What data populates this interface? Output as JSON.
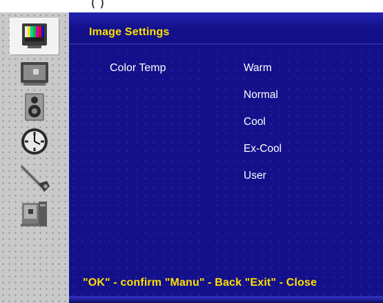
{
  "caption": "(                   )",
  "title": "Image Settings",
  "setting": {
    "label": "Color Temp"
  },
  "options": [
    "Warm",
    "Normal",
    "Cool",
    "Ex-Cool",
    "User"
  ],
  "footer": "\"OK\" - confirm \"Manu\" - Back \"Exit\" - Close",
  "sidebar": {
    "items": [
      {
        "icon": "color-bars-tv-icon",
        "selected": true
      },
      {
        "icon": "monitor-icon",
        "selected": false
      },
      {
        "icon": "speaker-icon",
        "selected": false
      },
      {
        "icon": "clock-icon",
        "selected": false
      },
      {
        "icon": "tools-icon",
        "selected": false
      },
      {
        "icon": "computer-tower-icon",
        "selected": false
      }
    ]
  },
  "colors": {
    "background": "#13108a",
    "title": "#ffe000",
    "text": "#ffffff",
    "sidebar": "#c9c9c9"
  }
}
